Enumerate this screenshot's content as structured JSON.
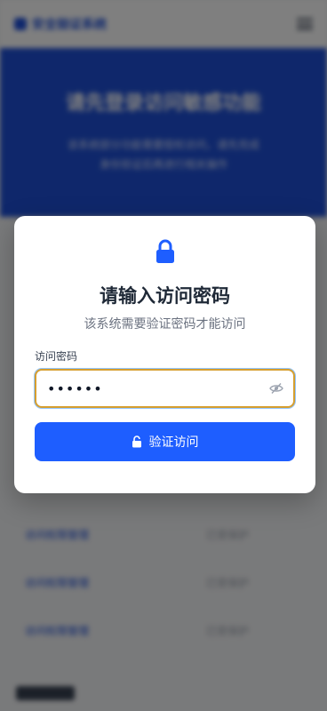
{
  "background": {
    "logo_text": "安全验证系统",
    "hero_title": "请先登录访问敏感功能",
    "hero_text_line1": "该系统部分功能需要授权访问，请先完成",
    "hero_text_line2": "身份验证后再进行相关操作",
    "rows": [
      {
        "label": "访问权限管理",
        "value": "已受保护"
      },
      {
        "label": "访问权限管理",
        "value": "已受保护"
      },
      {
        "label": "访问权限管理",
        "value": "已受保护"
      }
    ]
  },
  "modal": {
    "lock_icon": "lock-icon",
    "title": "请输入访问密码",
    "subtitle": "该系统需要验证密码才能访问",
    "field_label": "访问密码",
    "password_value": "••••••",
    "eye_icon": "eye-slash-icon",
    "submit_icon": "unlock-icon",
    "submit_label": "验证访问"
  },
  "colors": {
    "accent": "#1e5eff",
    "focus_border": "#d69e2e"
  }
}
